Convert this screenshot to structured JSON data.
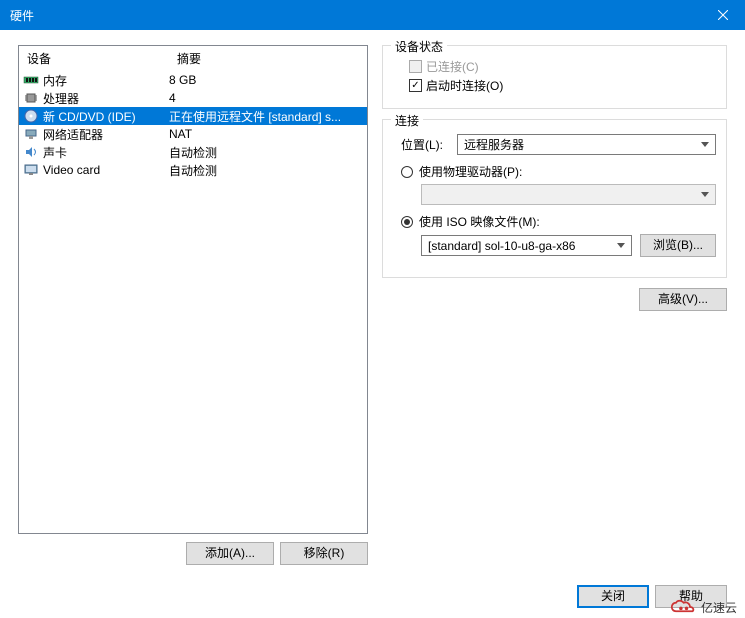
{
  "window": {
    "title": "硬件"
  },
  "device_list": {
    "headers": {
      "device": "设备",
      "summary": "摘要"
    },
    "rows": [
      {
        "icon": "memory",
        "device": "内存",
        "summary": "8 GB",
        "selected": false
      },
      {
        "icon": "cpu",
        "device": "处理器",
        "summary": "4",
        "selected": false
      },
      {
        "icon": "cd",
        "device": "新 CD/DVD (IDE)",
        "summary": "正在使用远程文件 [standard] s...",
        "selected": true
      },
      {
        "icon": "network",
        "device": "网络适配器",
        "summary": "NAT",
        "selected": false
      },
      {
        "icon": "sound",
        "device": "声卡",
        "summary": "自动检测",
        "selected": false
      },
      {
        "icon": "video",
        "device": "Video card",
        "summary": "自动检测",
        "selected": false
      }
    ],
    "buttons": {
      "add": "添加(A)...",
      "remove": "移除(R)"
    }
  },
  "device_status": {
    "title": "设备状态",
    "connected": {
      "label": "已连接(C)",
      "checked": false,
      "disabled": true
    },
    "connect_at_power_on": {
      "label": "启动时连接(O)",
      "checked": true,
      "disabled": false
    }
  },
  "connection": {
    "title": "连接",
    "location": {
      "label": "位置(L):",
      "value": "远程服务器"
    },
    "use_physical": {
      "label": "使用物理驱动器(P):",
      "checked": false,
      "value": ""
    },
    "use_iso": {
      "label": "使用 ISO 映像文件(M):",
      "checked": true,
      "value": "[standard] sol-10-u8-ga-x86"
    },
    "browse": "浏览(B)...",
    "advanced": "高级(V)..."
  },
  "footer": {
    "close": "关闭",
    "help": "帮助"
  },
  "watermark": "亿速云"
}
